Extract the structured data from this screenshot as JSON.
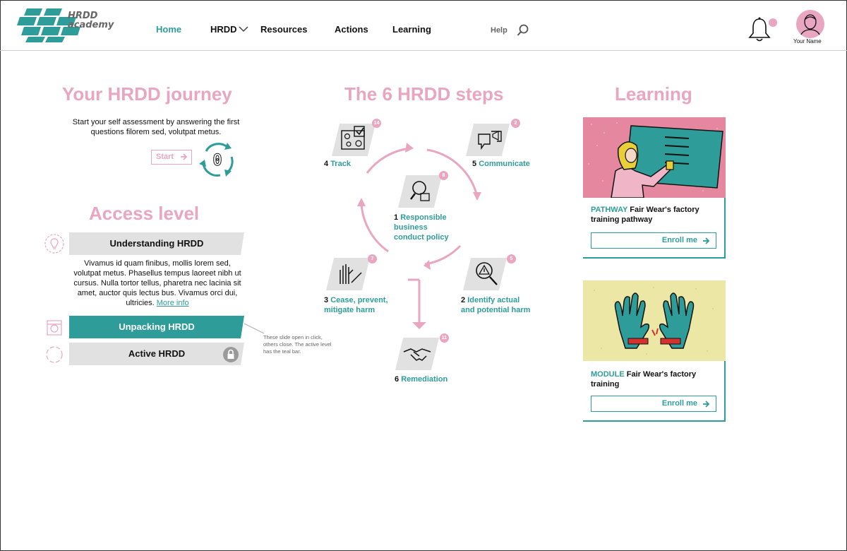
{
  "header": {
    "logo_line1": "HRDD",
    "logo_line2": "academy",
    "nav": [
      {
        "label": "Home",
        "active": true
      },
      {
        "label": "HRDD",
        "active": false
      },
      {
        "label": "Resources",
        "active": false
      },
      {
        "label": "Actions",
        "active": false
      },
      {
        "label": "Learning",
        "active": false
      }
    ],
    "help_label": "Help",
    "user_name": "Your Name"
  },
  "journey": {
    "title": "Your HRDD journey",
    "text": "Start your self assessment by answering the first questions  filorem sed, volutpat metus.",
    "start_label": "Start",
    "counter": "0"
  },
  "access": {
    "title": "Access level",
    "levels": [
      {
        "label": "Understanding HRDD",
        "state": "open"
      },
      {
        "label": "Unpacking HRDD",
        "state": "active"
      },
      {
        "label": "Active HRDD",
        "state": "locked"
      }
    ],
    "body": "Vivamus id quam finibus, mollis lorem sed, volutpat metus. Phasellus tempus laoreet nibh ut cursus. Nulla tortor tellus, pharetra nec lacinia sit amet, auctor quis lectus bus. Vivamus orci dui, ultricies.",
    "more_label": "More info",
    "note": "These slide open in click, others close. The active level has the teal bar."
  },
  "steps": {
    "title": "The 6 HRDD steps",
    "items": [
      {
        "num": "1",
        "label": "Responsible business conduct policy",
        "badge": "8",
        "icon": "magnifier-document-icon"
      },
      {
        "num": "2",
        "label": "Identify actual and potential harm",
        "badge": "5",
        "icon": "magnifier-warning-icon"
      },
      {
        "num": "3",
        "label": "Cease, prevent, mitigate harm",
        "badge": "7",
        "icon": "stop-hand-icon"
      },
      {
        "num": "4",
        "label": "Track",
        "badge": "14",
        "icon": "checklist-icon"
      },
      {
        "num": "5",
        "label": "Communicate",
        "badge": "2",
        "icon": "megaphone-icon"
      },
      {
        "num": "6",
        "label": "Remediation",
        "badge": "11",
        "icon": "handshake-icon"
      }
    ]
  },
  "learning": {
    "title": "Learning",
    "cards": [
      {
        "tag": "PATHWAY",
        "title": "Fair Wear's factory training pathway",
        "enroll_label": "Enroll me"
      },
      {
        "tag": "MODULE",
        "title": "Fair Wear's factory training",
        "enroll_label": "Enroll me"
      }
    ]
  },
  "colors": {
    "teal": "#2e9d9a",
    "pink": "#e8a6c0",
    "grey_bar": "#e1e1e1"
  }
}
